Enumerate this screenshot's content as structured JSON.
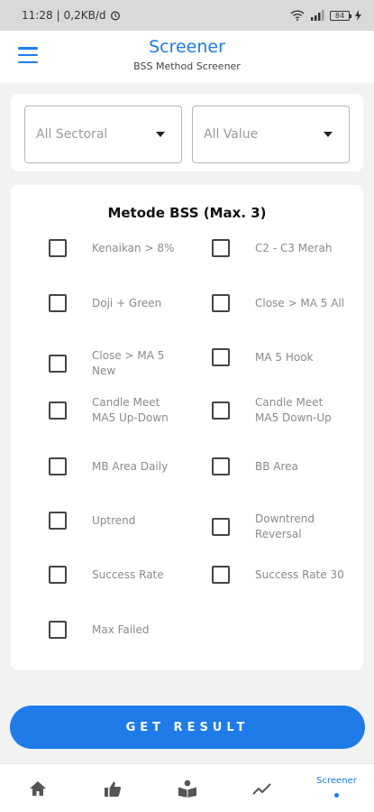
{
  "status_bar": {
    "time": "11:28",
    "network_speed": "0,2KB/d",
    "battery": "84"
  },
  "header": {
    "title": "Screener",
    "subtitle": "BSS Method Screener"
  },
  "filters": {
    "sectoral": "All Sectoral",
    "value": "All Value"
  },
  "method": {
    "title": "Metode BSS (Max. 3)",
    "options": [
      {
        "label": "Kenaikan > 8%",
        "checked": false
      },
      {
        "label": "C2 - C3 Merah",
        "checked": false
      },
      {
        "label": "Doji + Green",
        "checked": false
      },
      {
        "label": "Close > MA 5 All",
        "checked": false
      },
      {
        "label": "Close > MA 5 New",
        "checked": false
      },
      {
        "label": "MA 5 Hook",
        "checked": false
      },
      {
        "label": "Candle Meet MA5 Up-Down",
        "checked": false
      },
      {
        "label": "Candle Meet MA5 Down-Up",
        "checked": false
      },
      {
        "label": "MB Area Daily",
        "checked": false
      },
      {
        "label": "BB Area",
        "checked": false
      },
      {
        "label": "Uptrend",
        "checked": false
      },
      {
        "label": "Downtrend Reversal",
        "checked": false
      },
      {
        "label": "Success Rate",
        "checked": false
      },
      {
        "label": "Success Rate 30",
        "checked": false
      },
      {
        "label": "Max Failed",
        "checked": false
      }
    ]
  },
  "actions": {
    "get_result": "GET RESULT"
  },
  "bottom_nav": {
    "items": [
      {
        "icon": "home-icon"
      },
      {
        "icon": "thumbs-up-icon"
      },
      {
        "icon": "book-reader-icon"
      },
      {
        "icon": "trend-line-icon"
      },
      {
        "label": "Screener",
        "active": true
      }
    ]
  },
  "colors": {
    "accent": "#1e7be8",
    "background": "#f2f2f2"
  }
}
